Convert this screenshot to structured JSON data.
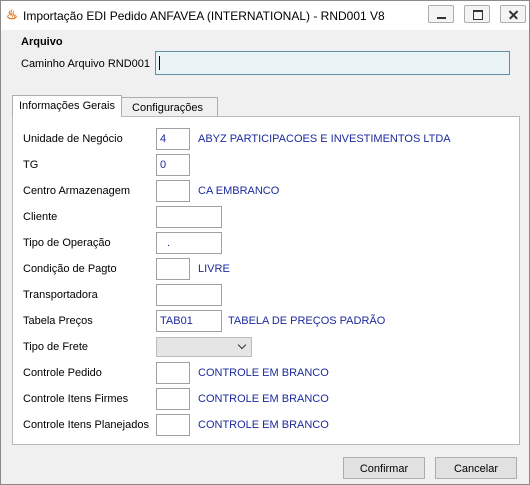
{
  "window": {
    "title": "Importação EDI Pedido ANFAVEA (INTERNATIONAL) - RND001 V8",
    "app_icon": "fire-icon"
  },
  "arquivo": {
    "group_title": "Arquivo",
    "path_label": "Caminho Arquivo RND001",
    "path_value": ""
  },
  "tabs": [
    {
      "label": "Informações Gerais",
      "active": true
    },
    {
      "label": "Configurações",
      "active": false
    }
  ],
  "form": {
    "unidade": {
      "label": "Unidade de Negócio",
      "value": "4",
      "desc": "ABYZ PARTICIPACOES E INVESTIMENTOS LTDA"
    },
    "tg": {
      "label": "TG",
      "value": "0"
    },
    "centro": {
      "label": "Centro Armazenagem",
      "value": "",
      "desc": "CA EMBRANCO"
    },
    "cliente": {
      "label": "Cliente",
      "value": ""
    },
    "tipo_operacao": {
      "label": "Tipo de Operação",
      "value": "."
    },
    "condicao": {
      "label": "Condição de Pagto",
      "value": "",
      "desc": "LIVRE"
    },
    "transportadora": {
      "label": "Transportadora",
      "value": ""
    },
    "tabela": {
      "label": "Tabela Preços",
      "value": "TAB01",
      "desc": "TABELA DE PREÇOS PADRÃO"
    },
    "tipo_frete": {
      "label": "Tipo de Frete",
      "value": ""
    },
    "controle_pedido": {
      "label": "Controle Pedido",
      "value": "",
      "desc": "CONTROLE EM BRANCO"
    },
    "controle_firmes": {
      "label": "Controle Itens Firmes",
      "value": "",
      "desc": "CONTROLE EM BRANCO"
    },
    "controle_planejados": {
      "label": "Controle Itens Planejados",
      "value": "",
      "desc": "CONTROLE EM BRANCO"
    }
  },
  "buttons": {
    "confirm": "Confirmar",
    "cancel": "Cancelar"
  },
  "colors": {
    "value_text": "#1d2a9c",
    "path_input_bg": "#e9f2f4"
  }
}
